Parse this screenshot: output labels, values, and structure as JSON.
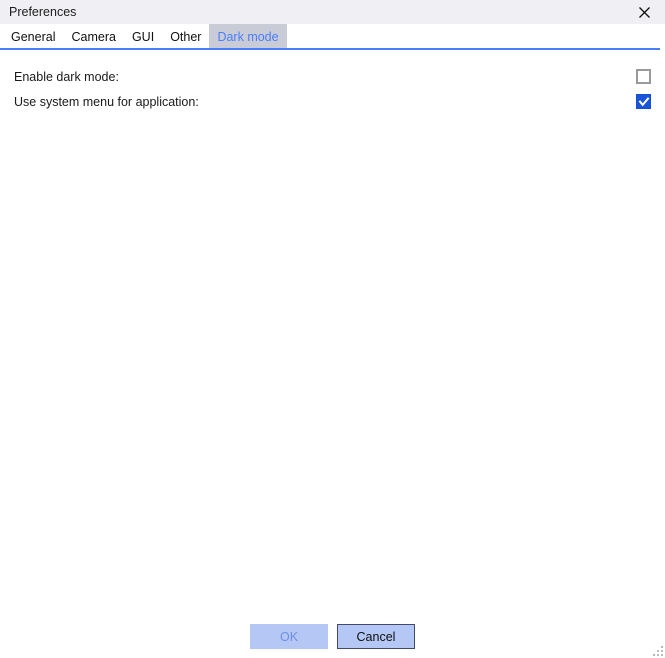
{
  "window": {
    "title": "Preferences",
    "close_icon": "close-icon"
  },
  "tabs": [
    {
      "label": "General",
      "selected": false
    },
    {
      "label": "Camera",
      "selected": false
    },
    {
      "label": "GUI",
      "selected": false
    },
    {
      "label": "Other",
      "selected": false
    },
    {
      "label": "Dark mode",
      "selected": true
    }
  ],
  "settings": [
    {
      "label": "Enable dark mode:",
      "checked": false
    },
    {
      "label": "Use system menu for application:",
      "checked": true
    }
  ],
  "footer": {
    "ok_label": "OK",
    "cancel_label": "Cancel"
  },
  "colors": {
    "accent": "#4a7dfc",
    "titlebar_bg": "#f0f0f4",
    "selected_tab_bg": "#c9ccd6",
    "checkbox_checked_bg": "#1a54d8",
    "button_bg": "#b4c7f5",
    "button_disabled_text": "#6f8fe0"
  }
}
